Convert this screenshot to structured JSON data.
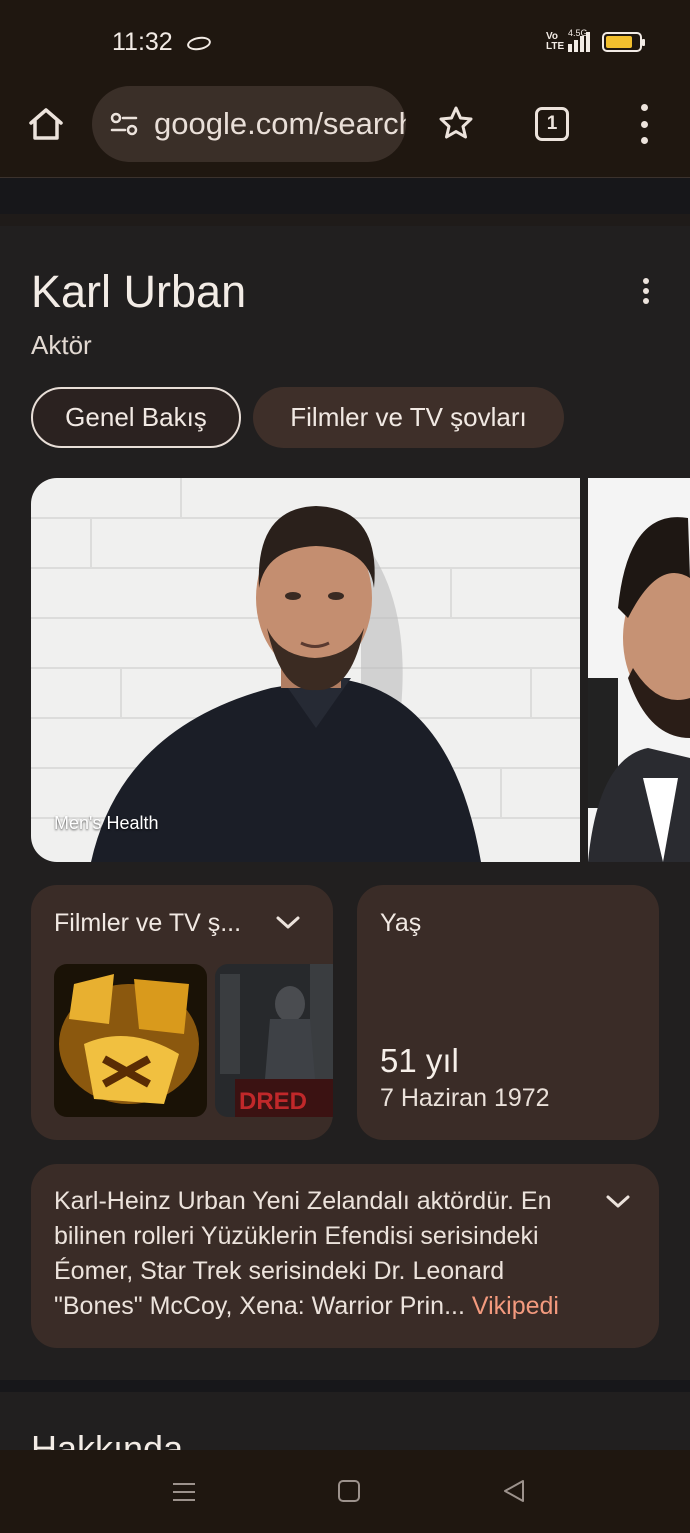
{
  "status_bar": {
    "time": "11:32",
    "network_label": "Vo LTE",
    "signal_label": "4.5G"
  },
  "browser": {
    "url": "google.com/search",
    "tab_count": "1"
  },
  "knowledge_panel": {
    "title": "Karl Urban",
    "subtitle": "Aktör",
    "chips": [
      {
        "label": "Genel Bakış",
        "selected": true
      },
      {
        "label": "Filmler ve TV şovları",
        "selected": false
      }
    ],
    "photo_credit": "Men's Health",
    "films_card": {
      "title": "Filmler ve TV ş..."
    },
    "age_card": {
      "label": "Yaş",
      "value": "51 yıl",
      "birth_date": "7 Haziran 1972"
    },
    "description": {
      "text": "Karl-Heinz Urban Yeni Zelandalı aktördür. En bilinen rolleri Yüzüklerin Efendisi serisindeki Éomer, Star Trek serisindeki Dr. Leonard \"Bones\" McCoy, Xena: Warrior Prin...",
      "link": "Vikipedi"
    }
  },
  "about_section": {
    "title": "Hakkında"
  },
  "icons": {
    "home": "home-icon",
    "site_info": "tune-icon",
    "bookmark": "star-icon",
    "more": "more-vert-icon"
  },
  "colors": {
    "link": "#f39a7e",
    "card": "#3a2c27",
    "battery": "#f2bf2e"
  }
}
